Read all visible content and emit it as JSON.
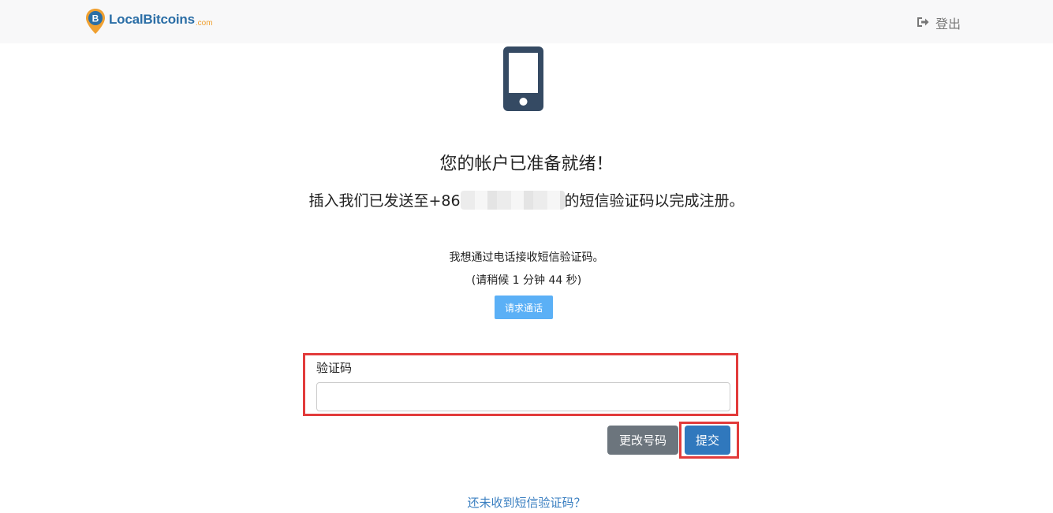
{
  "header": {
    "logo_text": "LocalBitcoins",
    "logo_domain": ".com",
    "logout_label": "登出"
  },
  "main": {
    "title": "您的帐户已准备就绪！",
    "subtitle_prefix": "插入我们已发送至+86",
    "subtitle_suffix": "的短信验证码以完成注册。",
    "call_text": "我想通过电话接收短信验证码。",
    "call_wait": "(请稍候 1 分钟 44 秒)",
    "call_button_label": "请求通话"
  },
  "form": {
    "code_label": "验证码",
    "code_value": "",
    "change_number_label": "更改号码",
    "submit_label": "提交"
  },
  "footer": {
    "help_link": "还未收到短信验证码？"
  },
  "colors": {
    "brand_blue": "#2b6ea6",
    "brand_orange": "#f0a030",
    "highlight_red": "#e23b3b",
    "call_button": "#5bb0f6",
    "submit_button": "#3078bd",
    "secondary_button": "#6c757d",
    "phone_icon": "#354a63"
  },
  "icons": {
    "logo": "bitcoin-map-pin-icon",
    "logout": "sign-out-icon",
    "phone": "mobile-phone-icon"
  }
}
